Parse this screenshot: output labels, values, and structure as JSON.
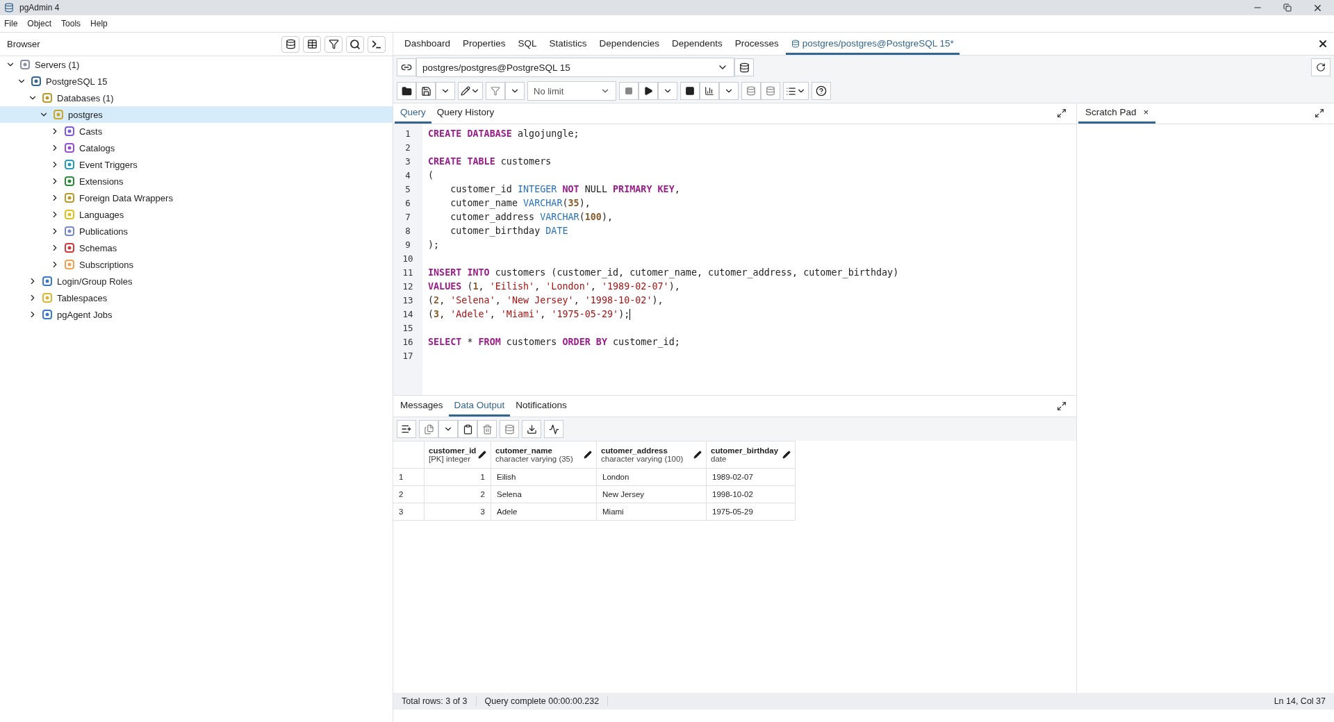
{
  "window": {
    "title": "pgAdmin 4"
  },
  "menu": [
    "File",
    "Object",
    "Tools",
    "Help"
  ],
  "browser": {
    "title": "Browser",
    "tree": [
      {
        "label": "Servers (1)",
        "kind": "servers",
        "expanded": true,
        "selected": false,
        "children": [
          {
            "label": "PostgreSQL 15",
            "kind": "server",
            "expanded": true,
            "selected": false,
            "children": [
              {
                "label": "Databases (1)",
                "kind": "databases",
                "expanded": true,
                "selected": false,
                "children": [
                  {
                    "label": "postgres",
                    "kind": "database",
                    "expanded": true,
                    "selected": true,
                    "children": [
                      {
                        "label": "Casts",
                        "kind": "casts",
                        "expanded": false,
                        "selected": false
                      },
                      {
                        "label": "Catalogs",
                        "kind": "catalogs",
                        "expanded": false,
                        "selected": false
                      },
                      {
                        "label": "Event Triggers",
                        "kind": "triggers",
                        "expanded": false,
                        "selected": false
                      },
                      {
                        "label": "Extensions",
                        "kind": "extensions",
                        "expanded": false,
                        "selected": false
                      },
                      {
                        "label": "Foreign Data Wrappers",
                        "kind": "databases",
                        "expanded": false,
                        "selected": false
                      },
                      {
                        "label": "Languages",
                        "kind": "languages",
                        "expanded": false,
                        "selected": false
                      },
                      {
                        "label": "Publications",
                        "kind": "publications",
                        "expanded": false,
                        "selected": false
                      },
                      {
                        "label": "Schemas",
                        "kind": "schemas",
                        "expanded": false,
                        "selected": false
                      },
                      {
                        "label": "Subscriptions",
                        "kind": "subscriptions",
                        "expanded": false,
                        "selected": false
                      }
                    ]
                  }
                ]
              },
              {
                "label": "Login/Group Roles",
                "kind": "roles",
                "expanded": false,
                "selected": false
              },
              {
                "label": "Tablespaces",
                "kind": "tablespaces",
                "expanded": false,
                "selected": false
              },
              {
                "label": "pgAgent Jobs",
                "kind": "jobs",
                "expanded": false,
                "selected": false
              }
            ]
          }
        ]
      }
    ]
  },
  "tabs": [
    {
      "label": "Dashboard",
      "selected": false
    },
    {
      "label": "Properties",
      "selected": false
    },
    {
      "label": "SQL",
      "selected": false
    },
    {
      "label": "Statistics",
      "selected": false
    },
    {
      "label": "Dependencies",
      "selected": false
    },
    {
      "label": "Dependents",
      "selected": false
    },
    {
      "label": "Processes",
      "selected": false
    },
    {
      "label": "postgres/postgres@PostgreSQL 15*",
      "selected": true
    }
  ],
  "connection": "postgres/postgres@PostgreSQL 15",
  "limit": "No limit",
  "editor_tabs": [
    {
      "label": "Query",
      "selected": true
    },
    {
      "label": "Query History",
      "selected": false
    }
  ],
  "scratch_pad": {
    "label": "Scratch Pad",
    "close": "×"
  },
  "code": [
    {
      "number": "1",
      "tokens": [
        {
          "text": "CREATE DATABASE",
          "kind": "kw"
        },
        {
          "text": " algojungle;",
          "kind": "plain"
        }
      ]
    },
    {
      "number": "2"
    },
    {
      "number": "3",
      "tokens": [
        {
          "text": "CREATE TABLE",
          "kind": "kw"
        },
        {
          "text": " customers",
          "kind": "plain"
        }
      ]
    },
    {
      "number": "4",
      "tokens": [
        {
          "text": "(",
          "kind": "plain"
        }
      ]
    },
    {
      "number": "5",
      "tokens": [
        {
          "text": "    customer_id ",
          "kind": "plain"
        },
        {
          "text": "INTEGER ",
          "kind": "type"
        },
        {
          "text": "NOT",
          "kind": "kw"
        },
        {
          "text": " NULL ",
          "kind": "plain"
        },
        {
          "text": "PRIMARY KEY",
          "kind": "kw"
        },
        {
          "text": ",",
          "kind": "plain"
        }
      ]
    },
    {
      "number": "6",
      "tokens": [
        {
          "text": "    cutomer_name ",
          "kind": "plain"
        },
        {
          "text": "VARCHAR",
          "kind": "type"
        },
        {
          "text": "(",
          "kind": "plain"
        },
        {
          "text": "35",
          "kind": "num"
        },
        {
          "text": "),",
          "kind": "plain"
        }
      ]
    },
    {
      "number": "7",
      "tokens": [
        {
          "text": "    cutomer_address ",
          "kind": "plain"
        },
        {
          "text": "VARCHAR",
          "kind": "type"
        },
        {
          "text": "(",
          "kind": "plain"
        },
        {
          "text": "100",
          "kind": "num"
        },
        {
          "text": "),",
          "kind": "plain"
        }
      ]
    },
    {
      "number": "8",
      "tokens": [
        {
          "text": "    cutomer_birthday ",
          "kind": "plain"
        },
        {
          "text": "DATE",
          "kind": "type"
        }
      ]
    },
    {
      "number": "9",
      "tokens": [
        {
          "text": ");",
          "kind": "plain"
        }
      ]
    },
    {
      "number": "10"
    },
    {
      "number": "11",
      "tokens": [
        {
          "text": "INSERT INTO",
          "kind": "kw"
        },
        {
          "text": " customers (customer_id, cutomer_name, cutomer_address, cutomer_birthday)",
          "kind": "plain"
        }
      ]
    },
    {
      "number": "12",
      "tokens": [
        {
          "text": "VALUES",
          "kind": "kw"
        },
        {
          "text": " (",
          "kind": "plain"
        },
        {
          "text": "1",
          "kind": "num"
        },
        {
          "text": ", ",
          "kind": "plain"
        },
        {
          "text": "'Eilish'",
          "kind": "str"
        },
        {
          "text": ", ",
          "kind": "plain"
        },
        {
          "text": "'London'",
          "kind": "str"
        },
        {
          "text": ", ",
          "kind": "plain"
        },
        {
          "text": "'1989-02-07'",
          "kind": "str"
        },
        {
          "text": "),",
          "kind": "plain"
        }
      ]
    },
    {
      "number": "13",
      "tokens": [
        {
          "text": "(",
          "kind": "plain"
        },
        {
          "text": "2",
          "kind": "num"
        },
        {
          "text": ", ",
          "kind": "plain"
        },
        {
          "text": "'Selena'",
          "kind": "str"
        },
        {
          "text": ", ",
          "kind": "plain"
        },
        {
          "text": "'New Jersey'",
          "kind": "str"
        },
        {
          "text": ", ",
          "kind": "plain"
        },
        {
          "text": "'1998-10-02'",
          "kind": "str"
        },
        {
          "text": "),",
          "kind": "plain"
        }
      ]
    },
    {
      "number": "14",
      "cursor": true,
      "tokens": [
        {
          "text": "(",
          "kind": "plain"
        },
        {
          "text": "3",
          "kind": "num"
        },
        {
          "text": ", ",
          "kind": "plain"
        },
        {
          "text": "'Adele'",
          "kind": "str"
        },
        {
          "text": ", ",
          "kind": "plain"
        },
        {
          "text": "'Miami'",
          "kind": "str"
        },
        {
          "text": ", ",
          "kind": "plain"
        },
        {
          "text": "'1975-05-29'",
          "kind": "str"
        },
        {
          "text": ");",
          "kind": "plain"
        }
      ]
    },
    {
      "number": "15"
    },
    {
      "number": "16",
      "tokens": [
        {
          "text": "SELECT",
          "kind": "kw"
        },
        {
          "text": " * ",
          "kind": "plain"
        },
        {
          "text": "FROM",
          "kind": "kw"
        },
        {
          "text": " customers ",
          "kind": "plain"
        },
        {
          "text": "ORDER BY",
          "kind": "kw"
        },
        {
          "text": " customer_id;",
          "kind": "plain"
        }
      ]
    },
    {
      "number": "17"
    }
  ],
  "result_tabs": [
    {
      "label": "Messages",
      "selected": false
    },
    {
      "label": "Data Output",
      "selected": true
    },
    {
      "label": "Notifications",
      "selected": false
    }
  ],
  "table": {
    "columns": [
      {
        "name": "customer_id",
        "type": "[PK] integer",
        "kind": "numeric"
      },
      {
        "name": "cutomer_name",
        "type": "character varying (35)",
        "kind": "text"
      },
      {
        "name": "cutomer_address",
        "type": "character varying (100)",
        "kind": "text"
      },
      {
        "name": "cutomer_birthday",
        "type": "date",
        "kind": "text"
      }
    ],
    "rows": [
      {
        "number": "1",
        "cells": [
          "1",
          "Eilish",
          "London",
          "1989-02-07"
        ]
      },
      {
        "number": "2",
        "cells": [
          "2",
          "Selena",
          "New Jersey",
          "1998-10-02"
        ]
      },
      {
        "number": "3",
        "cells": [
          "3",
          "Adele",
          "Miami",
          "1975-05-29"
        ]
      }
    ]
  },
  "status_bar": {
    "rows": "Total rows: 3 of 3",
    "query": "Query complete 00:00:00.232",
    "cursor": "Ln 14, Col 37"
  }
}
